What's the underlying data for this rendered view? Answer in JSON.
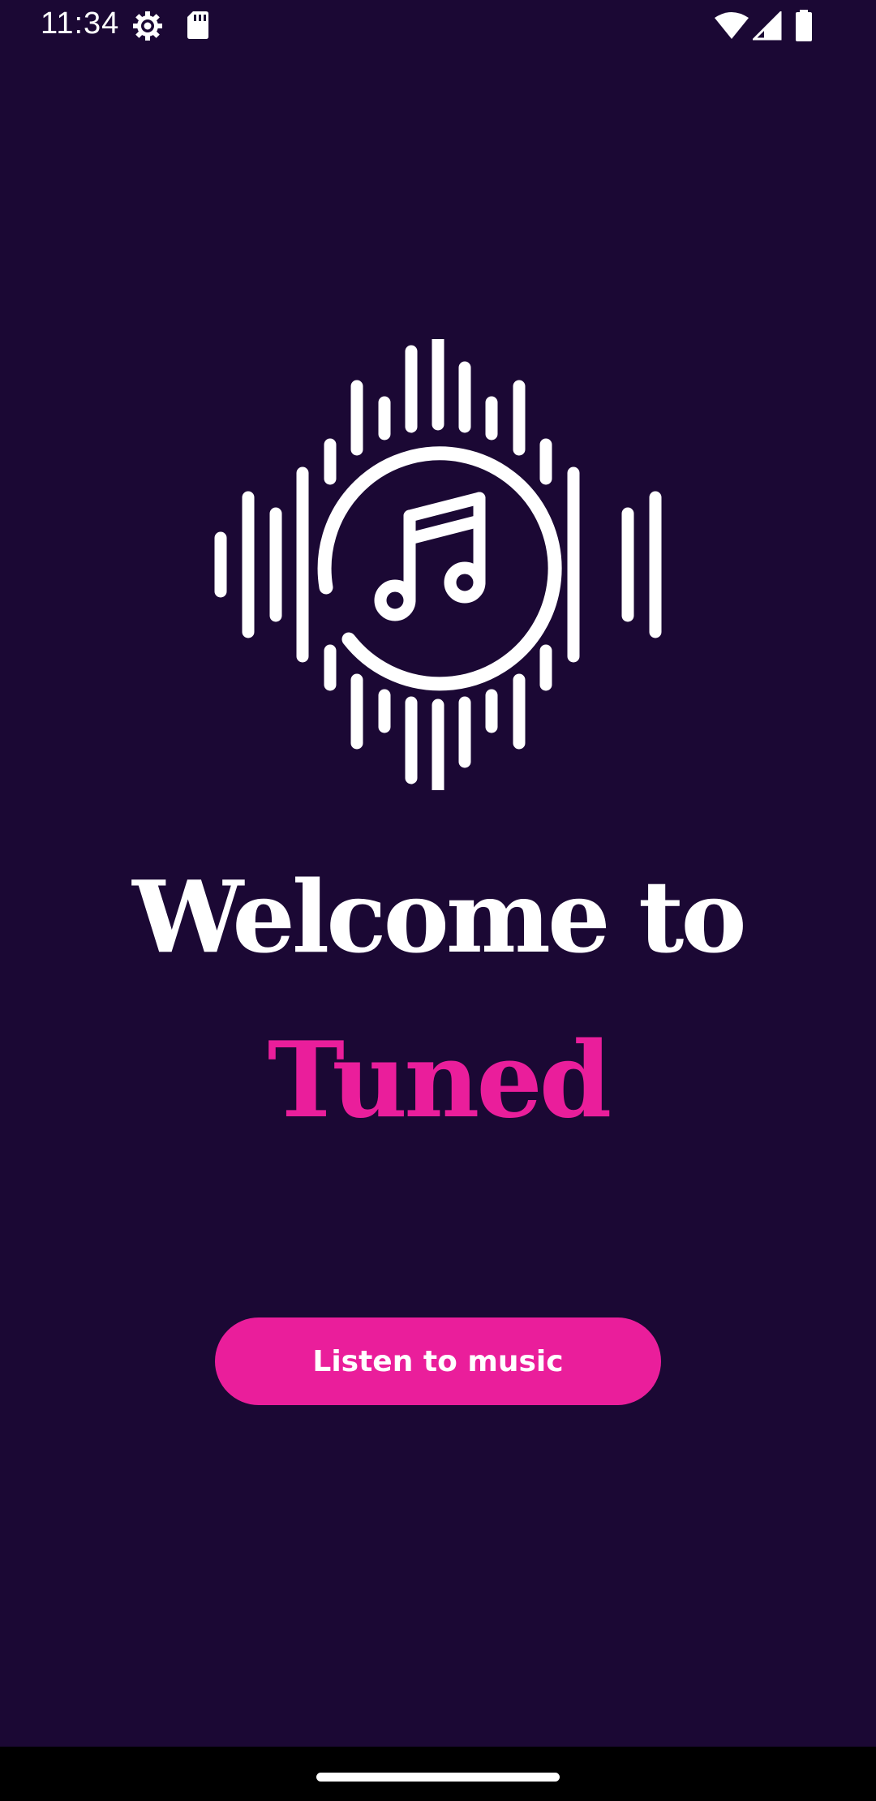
{
  "status_bar": {
    "time": "11:34",
    "left_icons": [
      "settings-gear-icon",
      "sd-card-icon"
    ],
    "right_icons": [
      "wifi-icon",
      "cell-signal-icon",
      "battery-icon"
    ]
  },
  "logo": {
    "icon": "music-note-soundwave-logo-icon"
  },
  "welcome": {
    "line1": "Welcome to",
    "brand": "Tuned"
  },
  "cta": {
    "label": "Listen to music"
  },
  "colors": {
    "background": "#1b0834",
    "accent": "#ea1e9b",
    "text": "#ffffff"
  }
}
